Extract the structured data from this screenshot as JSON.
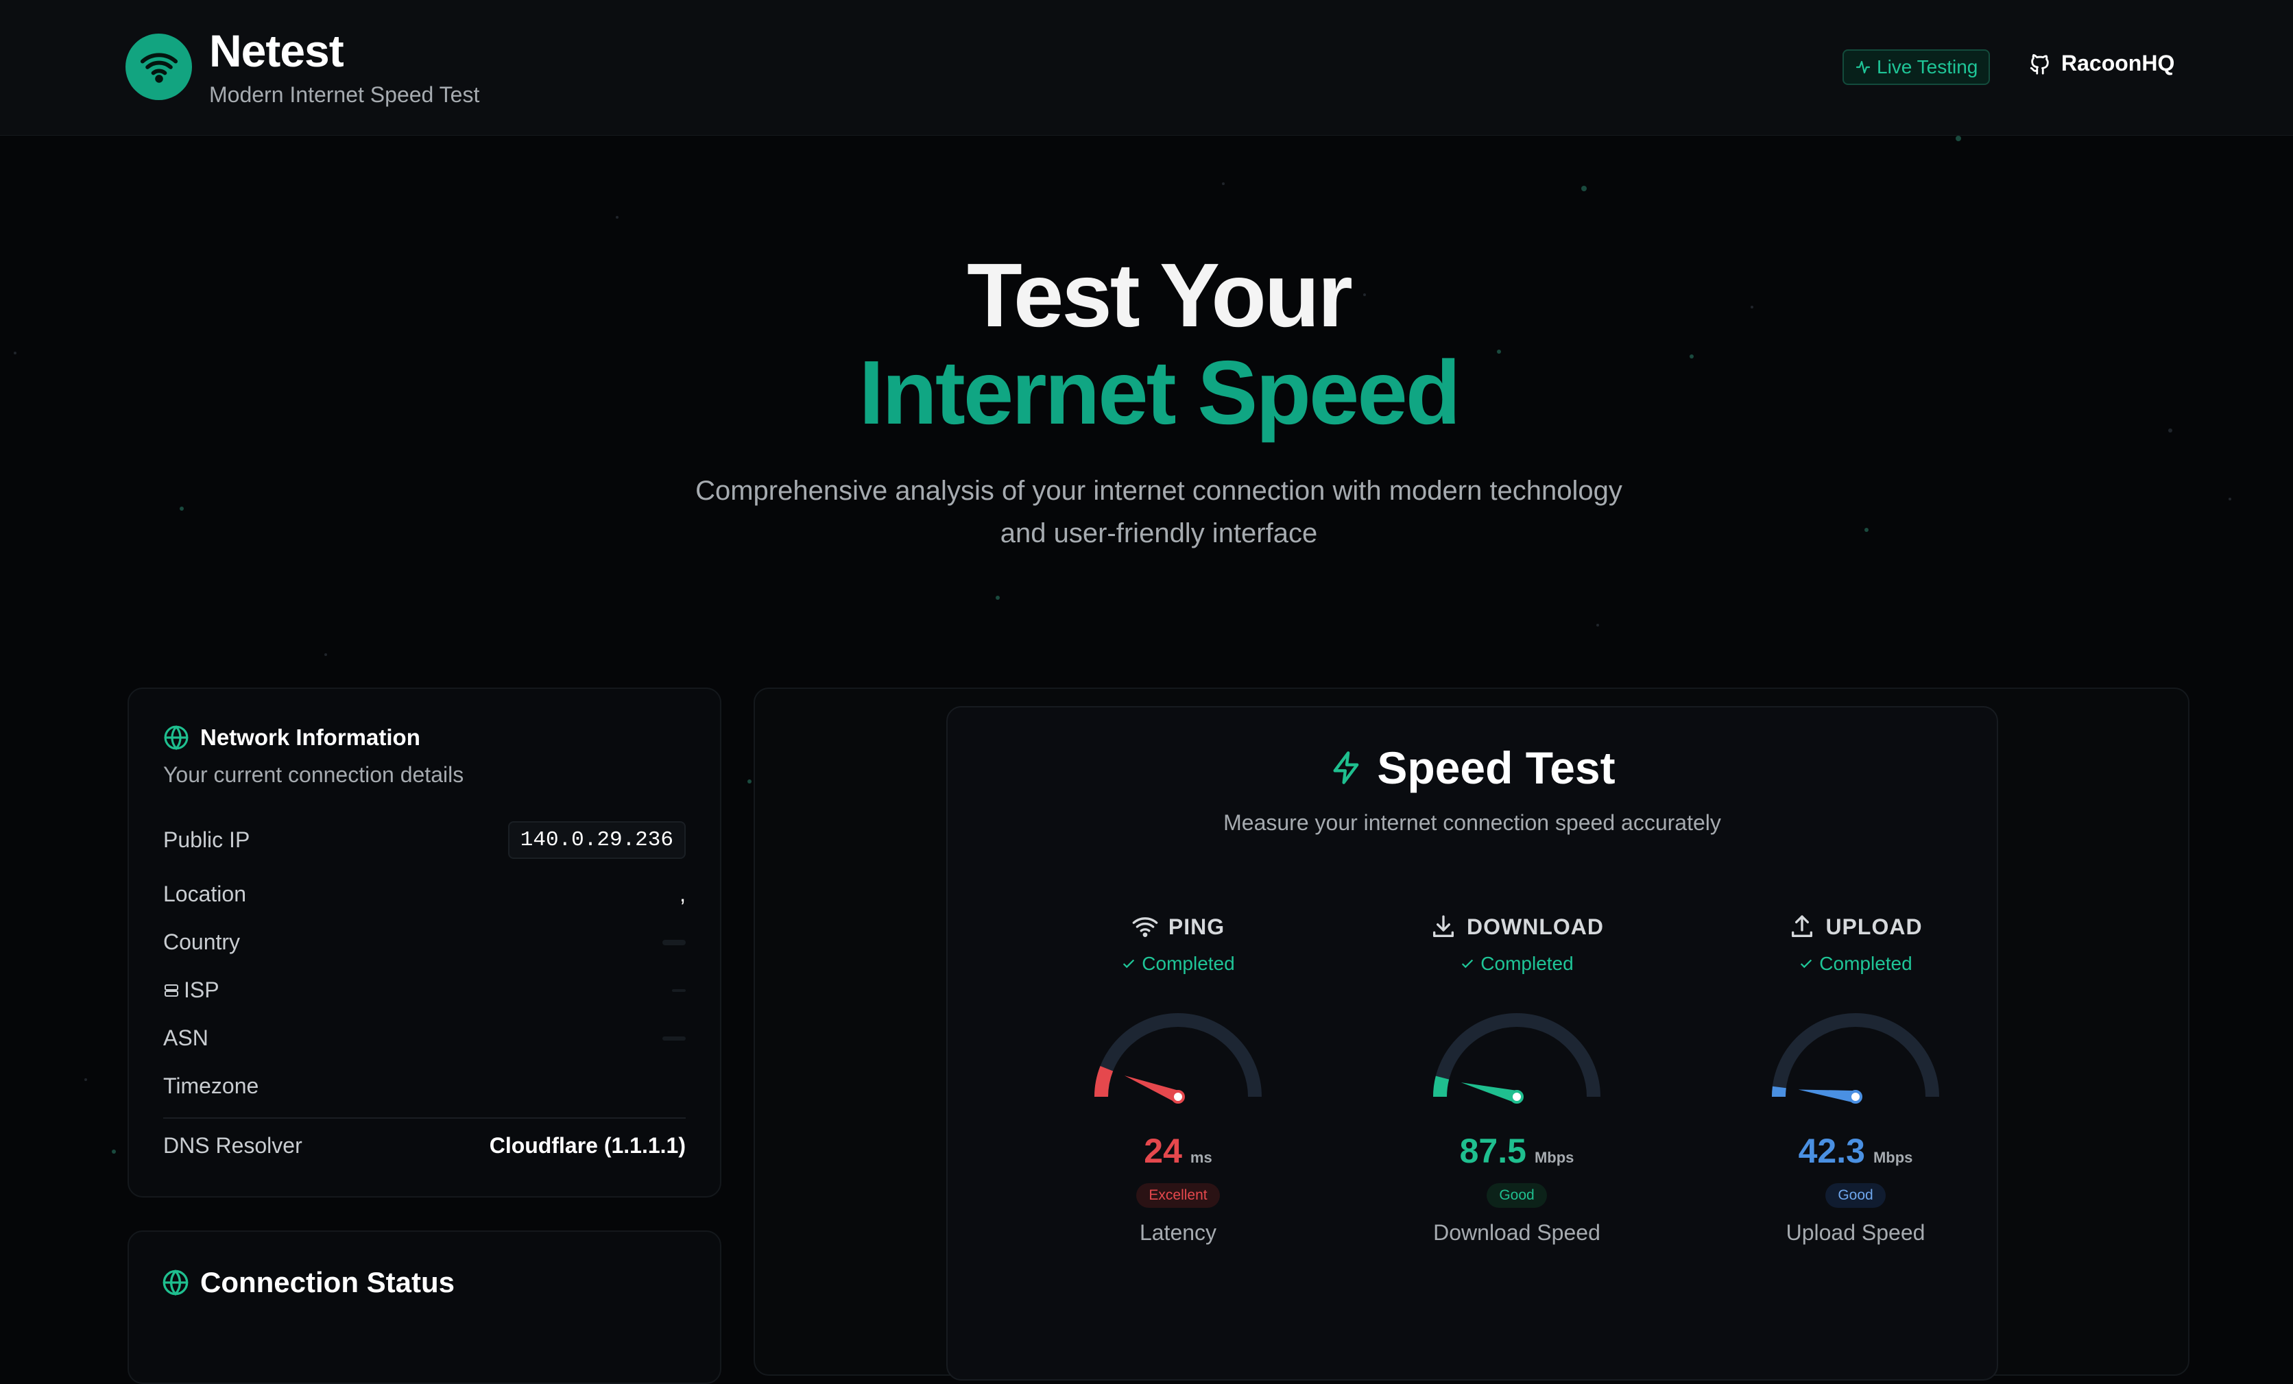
{
  "header": {
    "brand": "Netest",
    "tagline": "Modern Internet Speed Test",
    "live_badge": "Live Testing",
    "github_label": "RacoonHQ"
  },
  "hero": {
    "line1": "Test Your",
    "line2": "Internet Speed",
    "description": "Comprehensive analysis of your internet connection with modern technology and user-friendly interface"
  },
  "network": {
    "title": "Network Information",
    "subtitle": "Your current connection details",
    "public_ip_label": "Public IP",
    "public_ip": "140.0.29.236",
    "location_label": "Location",
    "location_value": ",",
    "country_label": "Country",
    "isp_label": "ISP",
    "asn_label": "ASN",
    "timezone_label": "Timezone",
    "dns_label": "DNS Resolver",
    "dns_value": "Cloudflare (1.1.1.1)"
  },
  "connection": {
    "title": "Connection Status"
  },
  "speedtest": {
    "title": "Speed Test",
    "subtitle": "Measure your internet connection speed accurately",
    "metrics": [
      {
        "label": "PING",
        "status": "Completed",
        "value": "24",
        "unit": "ms",
        "rating": "Excellent",
        "caption": "Latency",
        "color": "#e5484d",
        "fill": 0.12
      },
      {
        "label": "DOWNLOAD",
        "status": "Completed",
        "value": "87.5",
        "unit": "Mbps",
        "rating": "Good",
        "caption": "Download Speed",
        "color": "#1fbf8f",
        "fill": 0.08
      },
      {
        "label": "UPLOAD",
        "status": "Completed",
        "value": "42.3",
        "unit": "Mbps",
        "rating": "Good",
        "caption": "Upload Speed",
        "color": "#4a90e2",
        "fill": 0.04
      }
    ]
  },
  "colors": {
    "accent": "#10a683",
    "background": "#050608",
    "ping": "#e5484d",
    "download": "#1fbf8f",
    "upload": "#4a90e2"
  },
  "icons": [
    "wifi-icon",
    "activity-icon",
    "github-icon",
    "globe-icon",
    "server-icon",
    "zap-icon",
    "download-icon",
    "upload-icon",
    "check-icon"
  ]
}
